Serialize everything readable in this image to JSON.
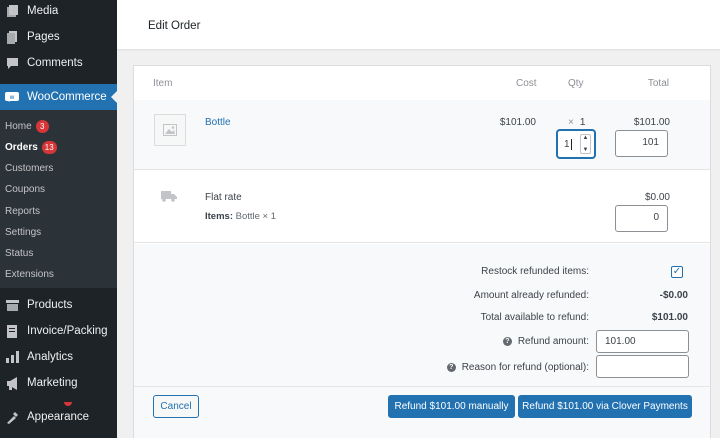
{
  "sidebar": {
    "menu": [
      {
        "label": "Media",
        "icon": "media-icon"
      },
      {
        "label": "Pages",
        "icon": "pages-icon"
      },
      {
        "label": "Comments",
        "icon": "comments-icon"
      },
      {
        "label": "WooCommerce",
        "icon": "woocommerce-icon"
      },
      {
        "label": "Products",
        "icon": "products-icon"
      },
      {
        "label": "Invoice/Packing",
        "icon": "invoice-icon"
      },
      {
        "label": "Analytics",
        "icon": "analytics-icon"
      },
      {
        "label": "Marketing",
        "icon": "marketing-icon"
      },
      {
        "label": "Appearance",
        "icon": "appearance-icon"
      }
    ],
    "submenu": [
      {
        "label": "Home",
        "badge": "3"
      },
      {
        "label": "Orders",
        "badge": "13"
      },
      {
        "label": "Customers"
      },
      {
        "label": "Coupons"
      },
      {
        "label": "Reports"
      },
      {
        "label": "Settings"
      },
      {
        "label": "Status"
      },
      {
        "label": "Extensions"
      }
    ]
  },
  "header": {
    "title": "Edit Order"
  },
  "table": {
    "columns": {
      "item": "Item",
      "cost": "Cost",
      "qty": "Qty",
      "total": "Total"
    },
    "line_item": {
      "name": "Bottle",
      "cost": "$101.00",
      "qty_prefix": "×",
      "qty": "1",
      "total": "$101.00",
      "refund_qty": "1",
      "refund_total": "101"
    },
    "shipping": {
      "name": "Flat rate",
      "items_label": "Items:",
      "items_value": "Bottle × 1",
      "total": "$0.00",
      "refund_total": "0"
    }
  },
  "refund": {
    "restock_label": "Restock refunded items:",
    "restock_checked": true,
    "already_refunded_label": "Amount already refunded:",
    "already_refunded_value": "-$0.00",
    "available_label": "Total available to refund:",
    "available_value": "$101.00",
    "amount_label": "Refund amount:",
    "amount_value": "101.00",
    "reason_label": "Reason for refund (optional):",
    "reason_value": "",
    "cancel_label": "Cancel",
    "manual_label": "Refund $101.00 manually",
    "gateway_label": "Refund $101.00 via Clover Payments"
  },
  "colors": {
    "accent": "#2271b1",
    "sidebar": "#1d2327",
    "badge": "#d63638"
  }
}
